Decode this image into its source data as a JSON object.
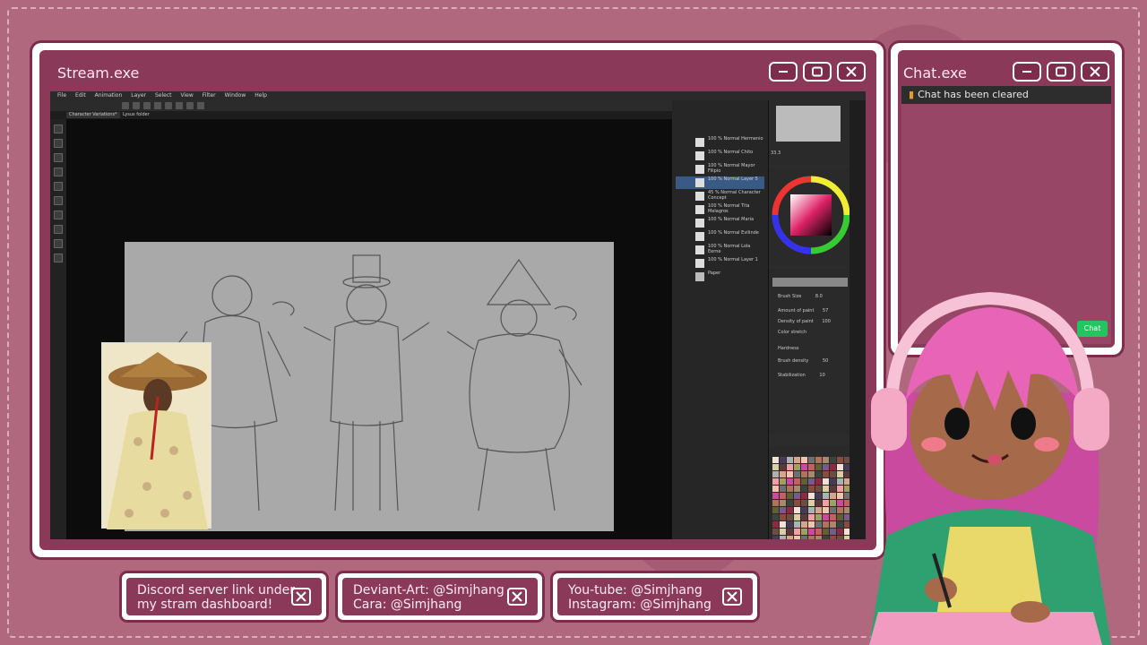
{
  "stream_window": {
    "title": "Stream.exe",
    "menu": [
      "File",
      "Edit",
      "Animation",
      "Layer",
      "Select",
      "View",
      "Filter",
      "Window",
      "Help"
    ],
    "tabs": [
      "Character Variations*",
      "Lysus folder"
    ],
    "layers": [
      {
        "name": "100 % Normal\nHermenio"
      },
      {
        "name": "100 % Normal\nChito"
      },
      {
        "name": "100 % Normal\nMayor Filipio"
      },
      {
        "name": "100 % Normal\nLayer 5",
        "selected": true
      },
      {
        "name": "45 % Normal\nCharacter Concept"
      },
      {
        "name": "100 % Normal\nTita Melagros"
      },
      {
        "name": "100 % Normal\nMaria"
      },
      {
        "name": "100 % Normal\nEvilinde"
      },
      {
        "name": "100 % Normal\nLola Eerne"
      },
      {
        "name": "100 % Normal\nLayer 1"
      },
      {
        "name": "Paper"
      }
    ],
    "brush_props": [
      {
        "label": "Brush Size",
        "value": "8.0"
      },
      {
        "label": "Amount of paint",
        "value": "57"
      },
      {
        "label": "Density of paint",
        "value": "100"
      },
      {
        "label": "Color stretch",
        "value": ""
      },
      {
        "label": "Hardness",
        "value": ""
      },
      {
        "label": "Brush density",
        "value": "50"
      },
      {
        "label": "Stabilization",
        "value": "10"
      }
    ],
    "zoom": "33.3"
  },
  "chat_window": {
    "title": "Chat.exe",
    "message": "Chat has been cleared",
    "chat_button": "Chat"
  },
  "cards": [
    {
      "line1": "Discord server link under",
      "line2": "my stram dashboard!"
    },
    {
      "line1": "Deviant-Art: @Simjhang",
      "line2": "Cara: @Simjhang"
    },
    {
      "line1": "You-tube: @Simjhang",
      "line2": "Instagram: @Simjhang"
    }
  ],
  "colors": {
    "frame_bg": "#8a3a58",
    "frame_border": "#ffffff",
    "page_bg": "#b0687e",
    "chat_green": "#22c55e"
  }
}
